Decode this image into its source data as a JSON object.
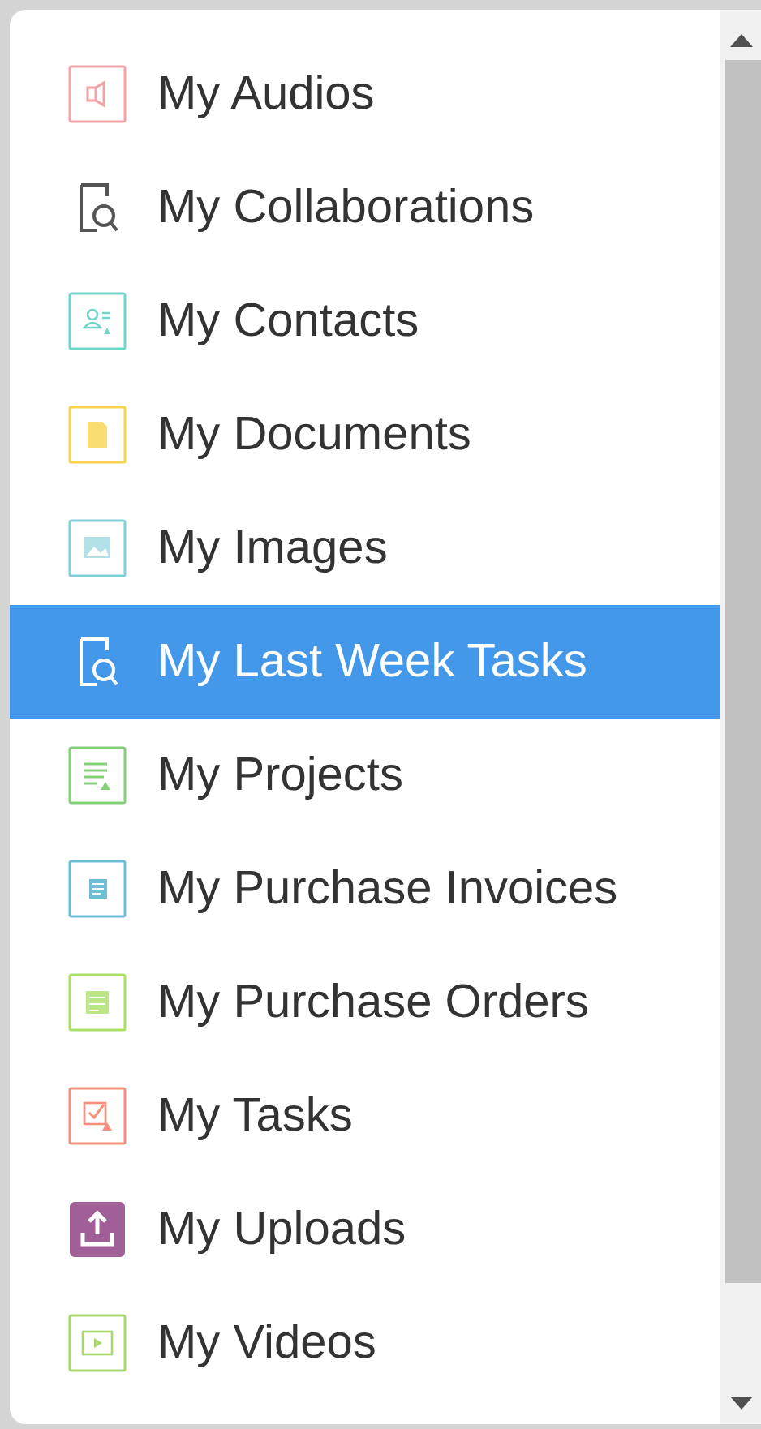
{
  "menu": {
    "items": [
      {
        "label": "My Audios",
        "kind": "audio",
        "color": "#f4a3a8",
        "selected": false
      },
      {
        "label": "My Collaborations",
        "kind": "search-doc",
        "color": "#555555",
        "selected": false
      },
      {
        "label": "My Contacts",
        "kind": "contacts",
        "color": "#6fd6c8",
        "selected": false
      },
      {
        "label": "My Documents",
        "kind": "document",
        "color": "#f7d44c",
        "selected": false
      },
      {
        "label": "My Images",
        "kind": "image",
        "color": "#7fcfd8",
        "selected": false
      },
      {
        "label": "My Last Week Tasks",
        "kind": "search-doc",
        "color": "#ffffff",
        "selected": true
      },
      {
        "label": "My Projects",
        "kind": "projects",
        "color": "#86d07a",
        "selected": false
      },
      {
        "label": "My Purchase Invoices",
        "kind": "invoice",
        "color": "#6cbfd6",
        "selected": false
      },
      {
        "label": "My Purchase Orders",
        "kind": "orders",
        "color": "#a9e06a",
        "selected": false
      },
      {
        "label": "My Tasks",
        "kind": "tasks",
        "color": "#f6907e",
        "selected": false
      },
      {
        "label": "My Uploads",
        "kind": "upload",
        "color": "#a05f96",
        "selected": false
      },
      {
        "label": "My Videos",
        "kind": "video",
        "color": "#a8d86a",
        "selected": false
      }
    ]
  }
}
